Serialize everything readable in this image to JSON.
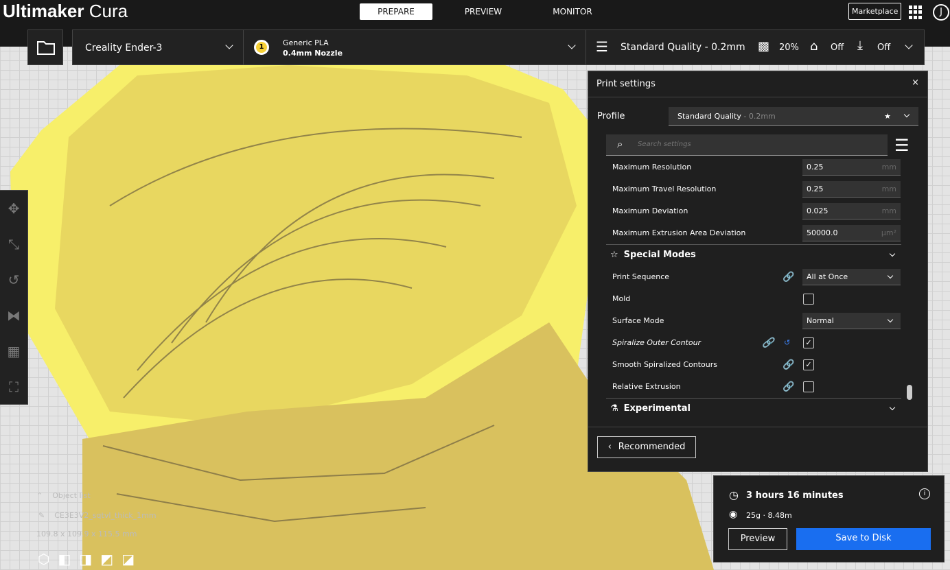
{
  "app": {
    "title_bold": "Ultimaker",
    "title_light": " Cura",
    "stages": [
      "PREPARE",
      "PREVIEW",
      "MONITOR"
    ],
    "marketplace": "Marketplace",
    "avatar": "J"
  },
  "printer": {
    "name": "Creality Ender-3"
  },
  "material": {
    "extruder": "1",
    "name": "Generic PLA",
    "nozzle": "0.4mm Nozzle"
  },
  "quality": {
    "profile": "Standard Quality - 0.2mm",
    "infill": "20%",
    "support": "Off",
    "adhesion": "Off"
  },
  "panel": {
    "title": "Print settings",
    "profile_label": "Profile",
    "profile_name": "Standard Quality",
    "profile_suffix": " - 0.2mm",
    "search_placeholder": "Search settings",
    "settings": [
      {
        "label": "Maximum Resolution",
        "value": "0.25",
        "unit": "mm"
      },
      {
        "label": "Maximum Travel Resolution",
        "value": "0.25",
        "unit": "mm"
      },
      {
        "label": "Maximum Deviation",
        "value": "0.025",
        "unit": "mm"
      },
      {
        "label": "Maximum Extrusion Area Deviation",
        "value": "50000.0",
        "unit": "μm²"
      }
    ],
    "special_modes": "Special Modes",
    "print_sequence": {
      "label": "Print Sequence",
      "value": "All at Once"
    },
    "mold": {
      "label": "Mold"
    },
    "surface_mode": {
      "label": "Surface Mode",
      "value": "Normal"
    },
    "spiralize": {
      "label": "Spiralize Outer Contour"
    },
    "smooth": {
      "label": "Smooth Spiralized Contours"
    },
    "relative": {
      "label": "Relative Extrusion"
    },
    "experimental": "Experimental",
    "recommended": "Recommended"
  },
  "object": {
    "list": "Object list",
    "name": "CE3E3V2_sqtvl_thick_1mm",
    "dims": "109.8 x 109.9 x 115.5 mm"
  },
  "estimate": {
    "time": "3 hours 16 minutes",
    "material": "25g · 8.48m",
    "preview": "Preview",
    "save": "Save to Disk"
  }
}
